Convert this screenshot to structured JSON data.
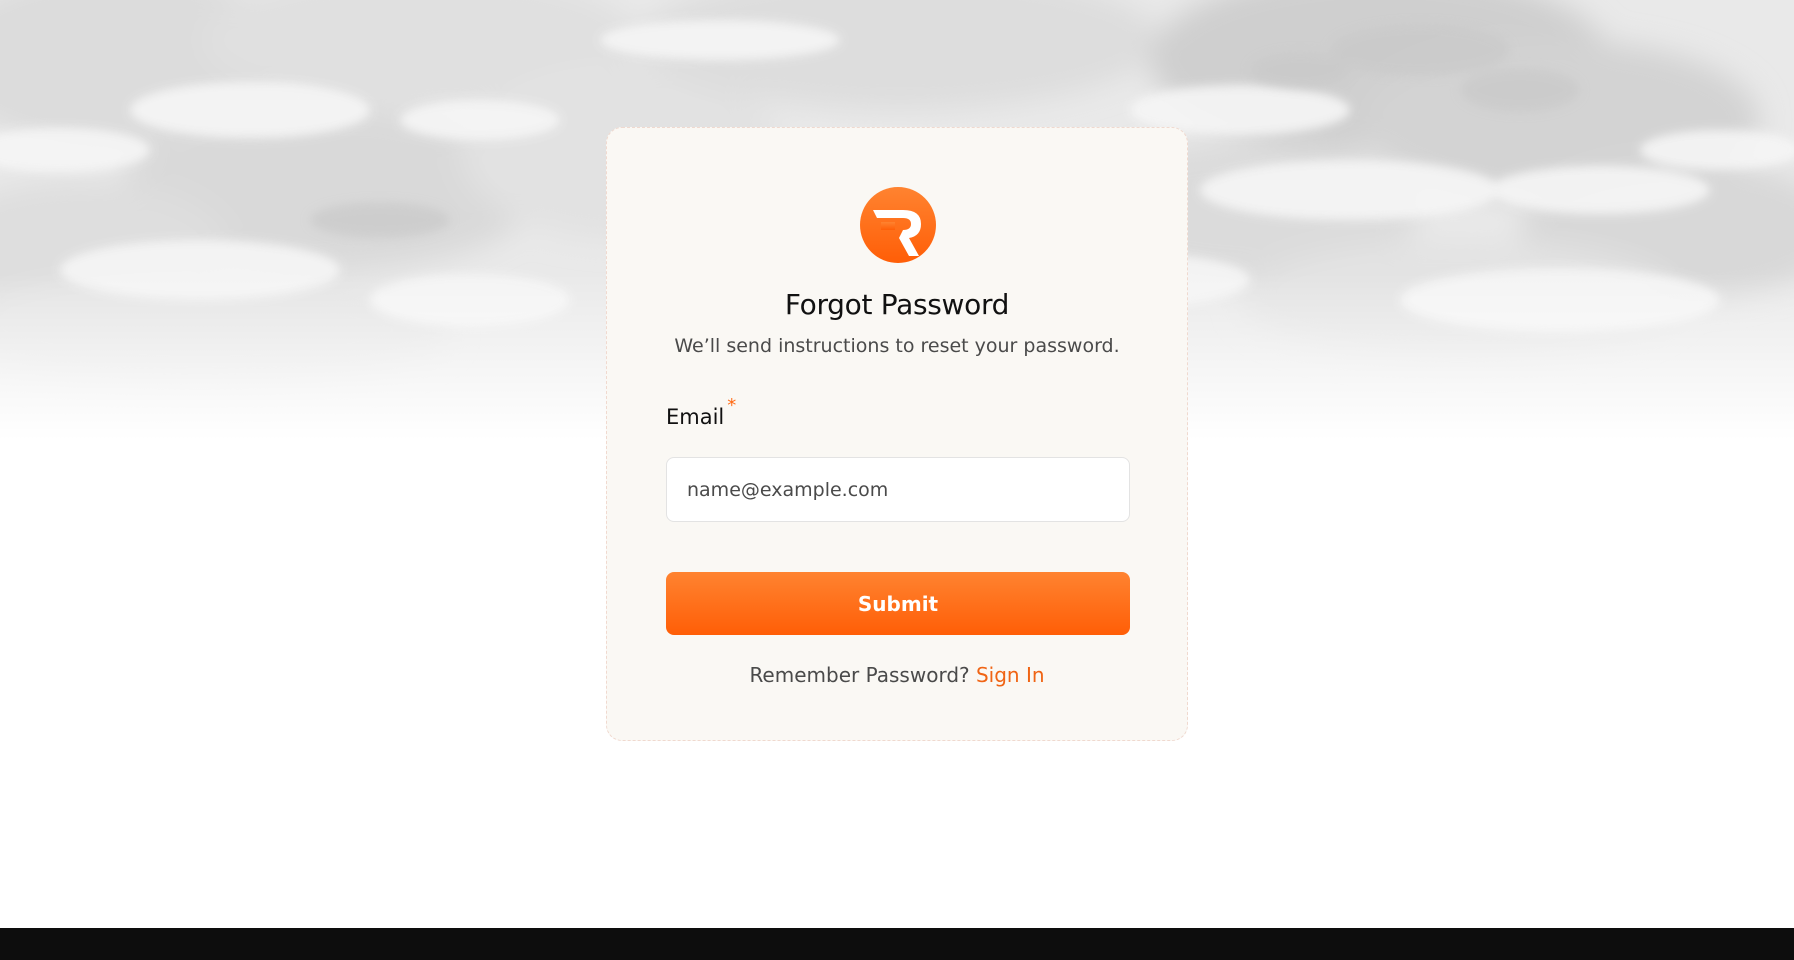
{
  "page": {
    "title": "Forgot Password",
    "subtitle": "We’ll send instructions to reset your password."
  },
  "form": {
    "email_label": "Email",
    "required_marker": "*",
    "email_placeholder": "name@example.com",
    "email_value": "",
    "submit_label": "Submit"
  },
  "footer_prompt": {
    "text": "Remember Password?",
    "link_label": "Sign In"
  },
  "icons": {
    "logo": "brand-r-logo-icon"
  },
  "colors": {
    "accent": "#ff6a14",
    "accent_gradient_top": "#ff8330",
    "accent_gradient_bottom": "#ff5e07",
    "card_background": "#faf8f4",
    "footer_bar": "#0d0d0d",
    "link": "#f06414"
  }
}
